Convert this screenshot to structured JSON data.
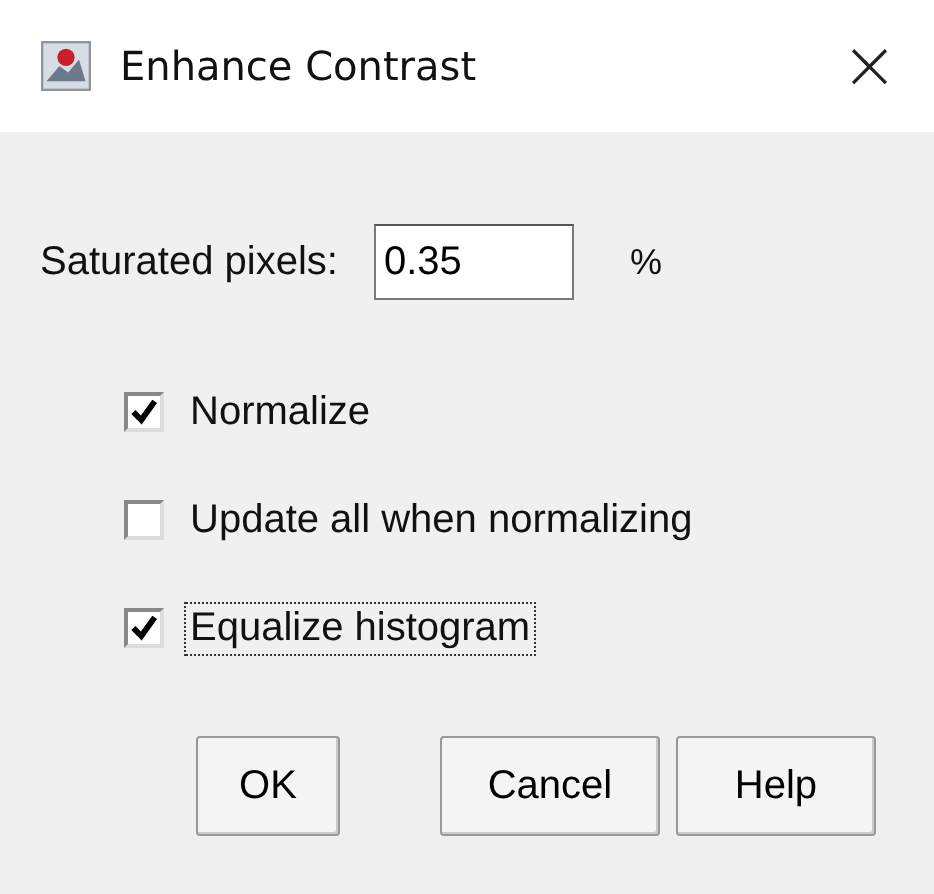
{
  "window": {
    "title": "Enhance Contrast",
    "close": "×"
  },
  "saturated": {
    "label": "Saturated pixels:",
    "value": "0.35",
    "unit": "%"
  },
  "checkboxes": [
    {
      "label": "Normalize",
      "checked": true,
      "focused": false
    },
    {
      "label": "Update all when normalizing",
      "checked": false,
      "focused": false
    },
    {
      "label": "Equalize histogram",
      "checked": true,
      "focused": true
    }
  ],
  "buttons": [
    "OK",
    "Cancel",
    "Help"
  ]
}
